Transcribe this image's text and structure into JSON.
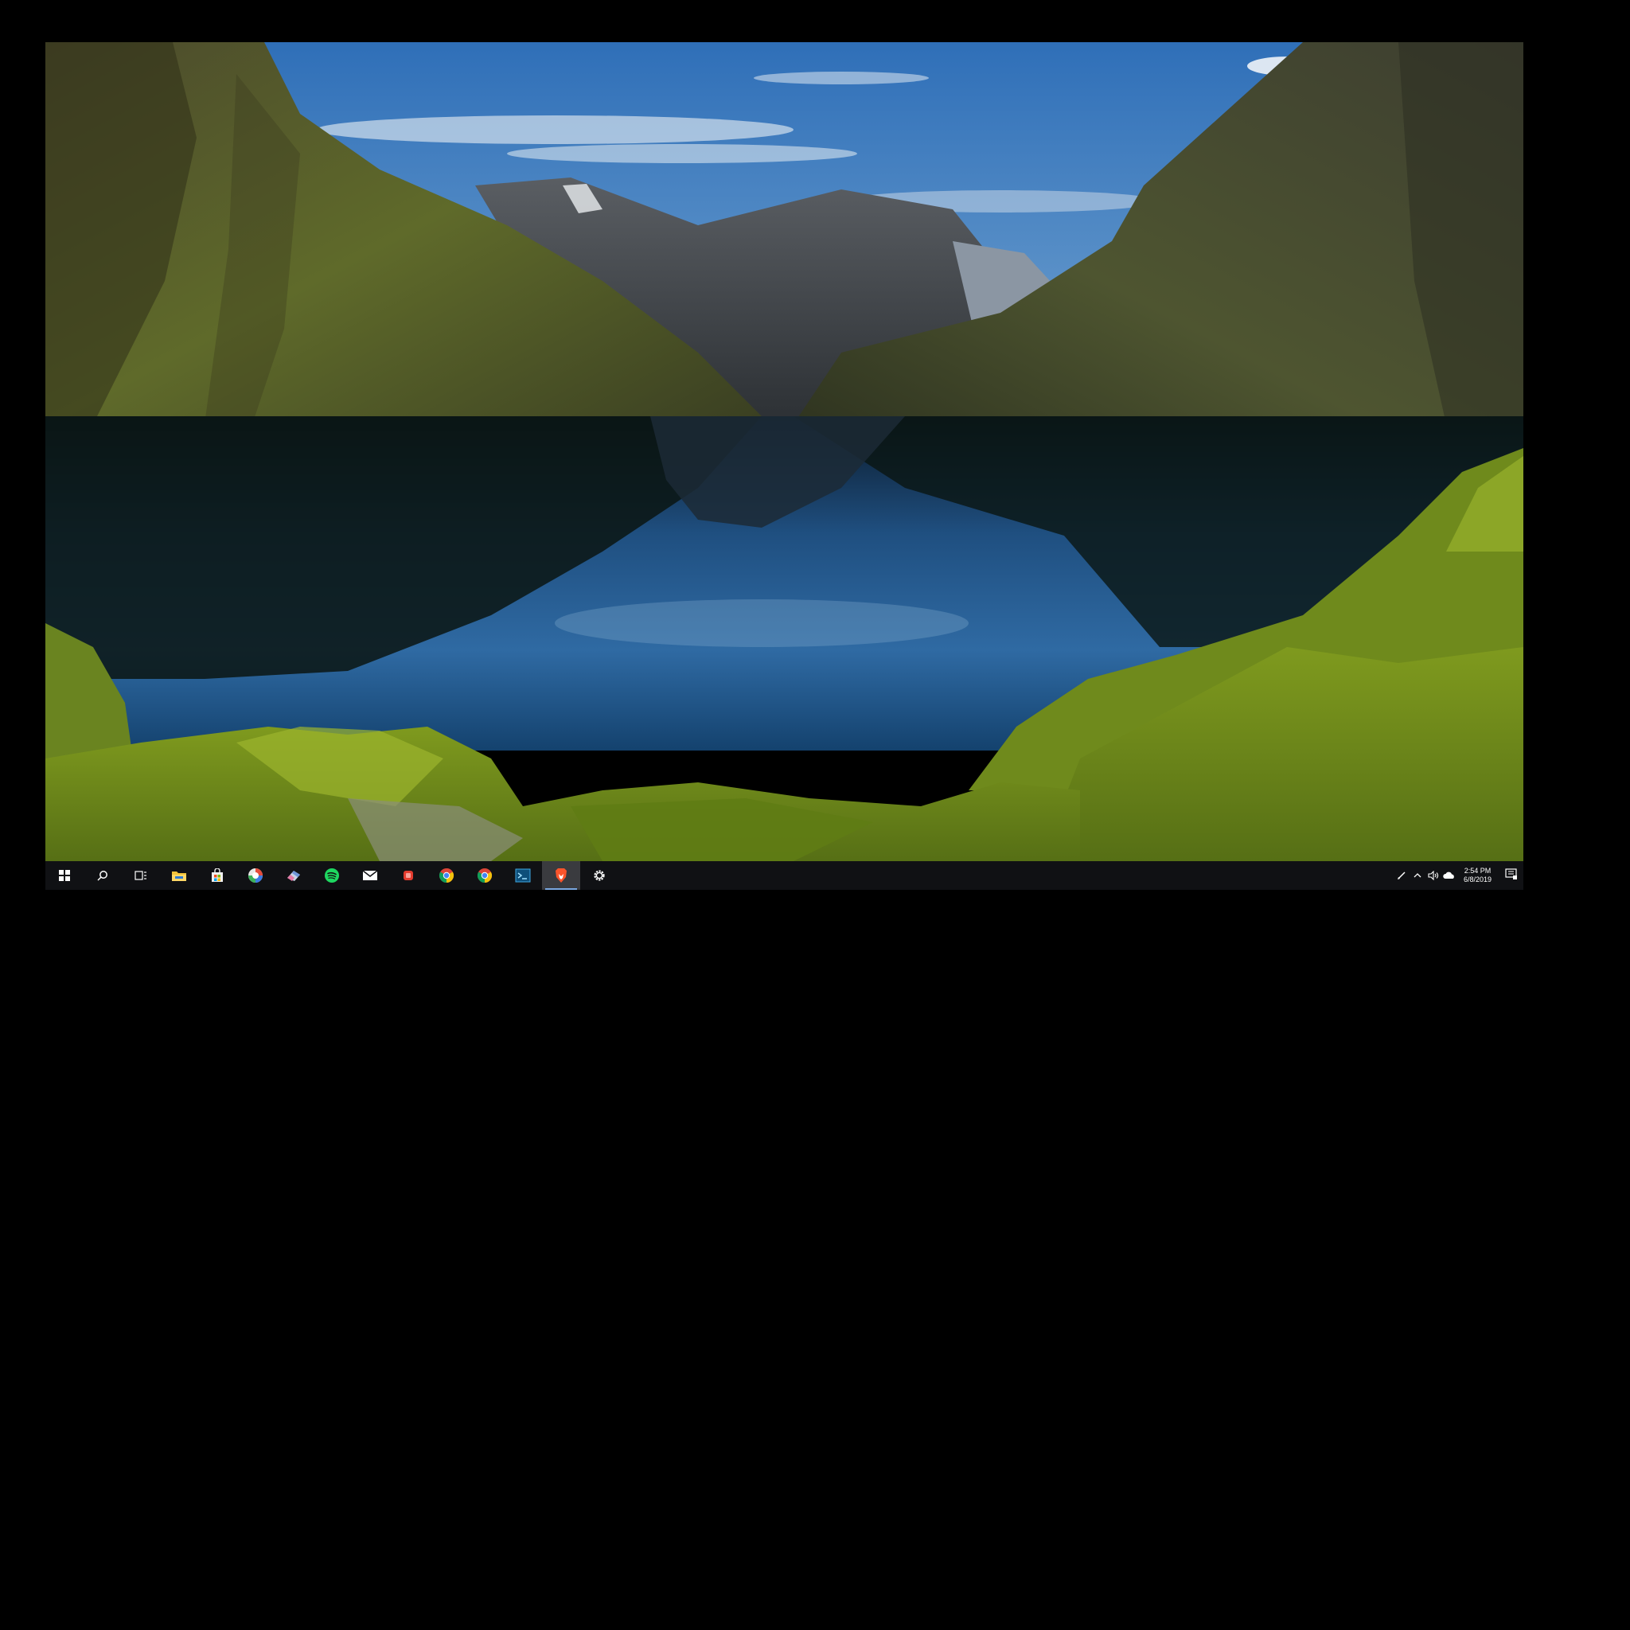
{
  "desktop": {
    "wallpaper": "mountain-lake-landscape"
  },
  "taskbar": {
    "background": "#101114",
    "items": [
      {
        "name": "start-button",
        "icon": "windows-logo-icon"
      },
      {
        "name": "search-button",
        "icon": "search-icon"
      },
      {
        "name": "task-view-button",
        "icon": "task-view-icon"
      },
      {
        "name": "file-explorer-button",
        "icon": "folder-icon"
      },
      {
        "name": "store-button",
        "icon": "store-bag-icon"
      },
      {
        "name": "app-button-1",
        "icon": "colorful-circle-icon"
      },
      {
        "name": "app-button-2",
        "icon": "eraser-icon"
      },
      {
        "name": "spotify-button",
        "icon": "spotify-icon"
      },
      {
        "name": "mail-button",
        "icon": "mail-icon"
      },
      {
        "name": "app-button-red",
        "icon": "red-app-icon"
      },
      {
        "name": "chrome-button-1",
        "icon": "chrome-icon"
      },
      {
        "name": "chrome-button-2",
        "icon": "chrome-icon"
      },
      {
        "name": "terminal-button",
        "icon": "terminal-icon"
      },
      {
        "name": "brave-button",
        "icon": "brave-lion-icon",
        "active": true
      },
      {
        "name": "settings-button",
        "icon": "gear-icon"
      }
    ],
    "tray": {
      "icons": [
        "pen-icon",
        "chevron-up-icon",
        "speaker-icon",
        "cloud-icon"
      ],
      "time": "2:54 PM",
      "date": "6/8/2019",
      "notification_icon": "action-center-icon"
    },
    "accent": "#7aa7e0"
  }
}
